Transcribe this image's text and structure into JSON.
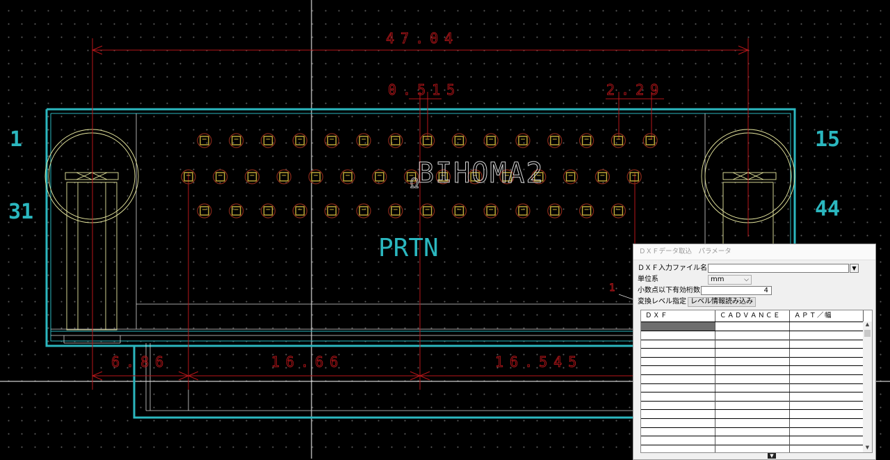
{
  "canvas": {
    "dimensions": [
      "47.04",
      "0.515",
      "2.29",
      "6.86",
      "16.66",
      "16.545"
    ],
    "pin_labels": [
      "1",
      "15",
      "31",
      "44"
    ],
    "part_name": "BIHOMA2",
    "ref_label": "PRTN",
    "small_marker": "1",
    "colors": {
      "background": "#000000",
      "outline": "#2bb7bf",
      "dimension": "#b8161a",
      "pad": "#c9b03a",
      "silk": "#e9e9a0",
      "crosshair": "#ffffff"
    }
  },
  "dialog": {
    "title": "ＤＸＦデータ取込　パラメータ",
    "file_label": "ＤＸＦ入力ファイル名",
    "file_value": "",
    "unit_label": "単位系",
    "unit_value": "mm",
    "digits_label": "小数点以下有効桁数",
    "digits_value": "4",
    "level_label": "変換レベル指定",
    "level_button": "レベル情報読み込み",
    "table": {
      "columns": [
        "ＤＸＦ",
        "ＣＡＤＶＡＮＣＥ",
        "ＡＰＴ／幅"
      ],
      "rows": 15
    },
    "icons": [
      "dropdown-arrow-icon",
      "chevron-down-icon",
      "scroll-up-icon",
      "scroll-down-icon"
    ]
  }
}
